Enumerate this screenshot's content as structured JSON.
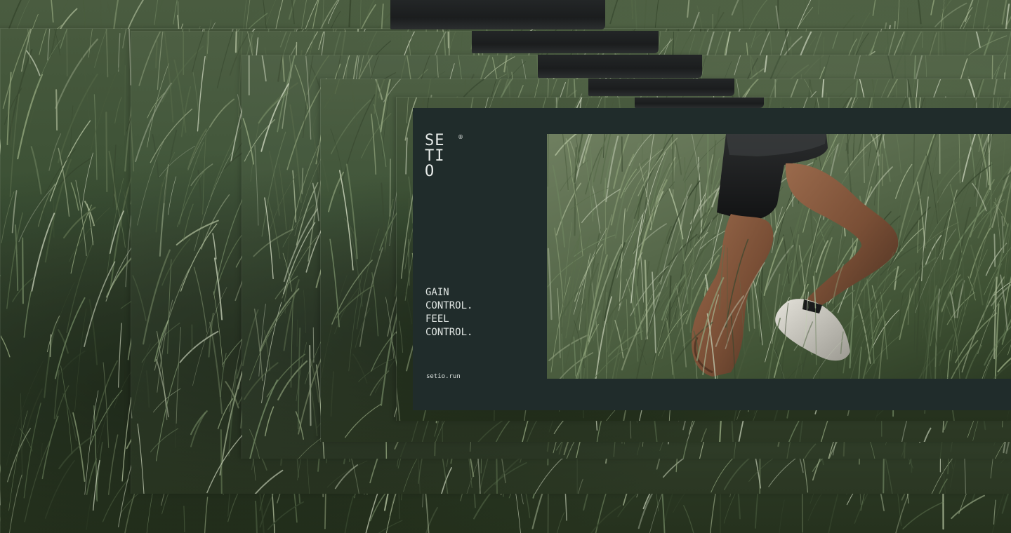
{
  "brand": {
    "logo_line_1": "SE",
    "logo_line_2": "TI",
    "logo_line_3": "O",
    "registered_mark": "®"
  },
  "tagline": {
    "line_1": "GAIN",
    "line_2": "CONTROL.",
    "line_3": "FEEL",
    "line_4": "CONTROL."
  },
  "link": {
    "url_text": "setio.run"
  },
  "colors": {
    "card_background": "#202c2b",
    "text": "#e8ecea",
    "grass_dark": "#27341f",
    "grass_light": "#6f7f60"
  }
}
